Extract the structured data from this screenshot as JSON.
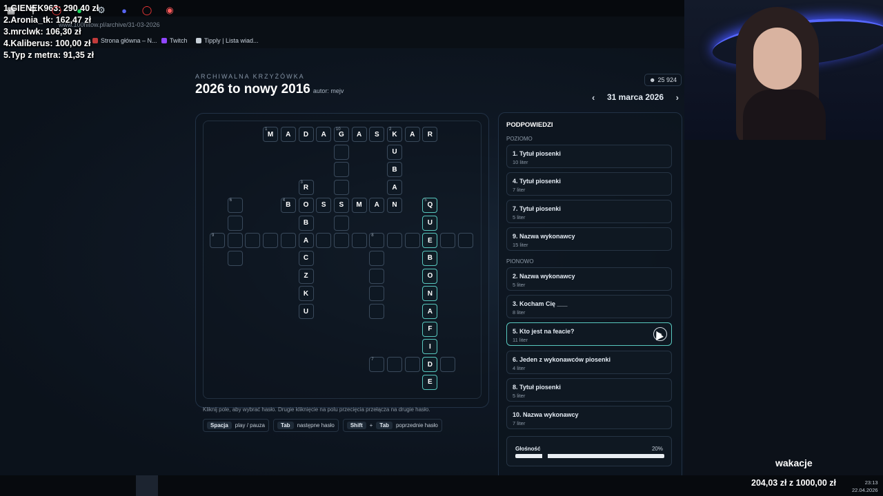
{
  "browser": {
    "url": "www.100hitow.pl/archive/31-03-2026",
    "bookmarks": [
      "Strona główna – N...",
      "Twitch",
      "Tipply | Lista wiad..."
    ]
  },
  "donors": [
    "1.GIENEK963: 290,40 zł",
    "2.Aronia_tk: 162,47 zł",
    "3.mrclwk: 106,30 zł",
    "4.Kaliberus: 100,00 zł",
    "5.Typ z metra: 91,35 zł"
  ],
  "header": {
    "subtitle": "ARCHIWALNA KRZYŻÓWKA",
    "title": "2026 to nowy 2016",
    "author": "autor: mejv",
    "count": "25 924",
    "date": "31 marca 2026"
  },
  "grid": {
    "cells": [
      {
        "r": 0,
        "c": 3,
        "n": "1",
        "ch": "M"
      },
      {
        "r": 0,
        "c": 4,
        "ch": "A"
      },
      {
        "r": 0,
        "c": 5,
        "ch": "D"
      },
      {
        "r": 0,
        "c": 6,
        "ch": "A"
      },
      {
        "r": 0,
        "c": 7,
        "n": "10",
        "ch": "G"
      },
      {
        "r": 0,
        "c": 8,
        "ch": "A"
      },
      {
        "r": 0,
        "c": 9,
        "ch": "S"
      },
      {
        "r": 0,
        "c": 10,
        "n": "2",
        "ch": "K"
      },
      {
        "r": 0,
        "c": 11,
        "ch": "A"
      },
      {
        "r": 0,
        "c": 12,
        "ch": "R"
      },
      {
        "r": 1,
        "c": 7,
        "ch": ""
      },
      {
        "r": 1,
        "c": 10,
        "ch": "U"
      },
      {
        "r": 2,
        "c": 7,
        "ch": ""
      },
      {
        "r": 2,
        "c": 10,
        "ch": "B"
      },
      {
        "r": 3,
        "c": 5,
        "n": "3",
        "ch": "R"
      },
      {
        "r": 3,
        "c": 7,
        "ch": ""
      },
      {
        "r": 3,
        "c": 10,
        "ch": "A"
      },
      {
        "r": 4,
        "c": 1,
        "n": "6",
        "ch": ""
      },
      {
        "r": 4,
        "c": 4,
        "n": "4",
        "ch": "B"
      },
      {
        "r": 4,
        "c": 5,
        "ch": "O"
      },
      {
        "r": 4,
        "c": 6,
        "ch": "S"
      },
      {
        "r": 4,
        "c": 7,
        "ch": "S"
      },
      {
        "r": 4,
        "c": 8,
        "ch": "M"
      },
      {
        "r": 4,
        "c": 9,
        "ch": "A"
      },
      {
        "r": 4,
        "c": 10,
        "ch": "N"
      },
      {
        "r": 4,
        "c": 12,
        "n": "5",
        "ch": "Q",
        "hl": true
      },
      {
        "r": 5,
        "c": 1,
        "ch": ""
      },
      {
        "r": 5,
        "c": 5,
        "ch": "B"
      },
      {
        "r": 5,
        "c": 7,
        "ch": ""
      },
      {
        "r": 5,
        "c": 12,
        "ch": "U",
        "hl": true
      },
      {
        "r": 6,
        "c": 0,
        "n": "9",
        "ch": ""
      },
      {
        "r": 6,
        "c": 1,
        "ch": ""
      },
      {
        "r": 6,
        "c": 2,
        "ch": ""
      },
      {
        "r": 6,
        "c": 3,
        "ch": ""
      },
      {
        "r": 6,
        "c": 4,
        "ch": ""
      },
      {
        "r": 6,
        "c": 5,
        "ch": "A"
      },
      {
        "r": 6,
        "c": 6,
        "ch": ""
      },
      {
        "r": 6,
        "c": 7,
        "ch": ""
      },
      {
        "r": 6,
        "c": 8,
        "ch": ""
      },
      {
        "r": 6,
        "c": 9,
        "n": "8",
        "ch": ""
      },
      {
        "r": 6,
        "c": 10,
        "ch": ""
      },
      {
        "r": 6,
        "c": 11,
        "ch": ""
      },
      {
        "r": 6,
        "c": 12,
        "ch": "E",
        "hl": true
      },
      {
        "r": 6,
        "c": 13,
        "ch": ""
      },
      {
        "r": 6,
        "c": 14,
        "ch": ""
      },
      {
        "r": 7,
        "c": 1,
        "ch": ""
      },
      {
        "r": 7,
        "c": 5,
        "ch": "C"
      },
      {
        "r": 7,
        "c": 9,
        "ch": ""
      },
      {
        "r": 7,
        "c": 12,
        "ch": "B",
        "hl": true
      },
      {
        "r": 8,
        "c": 5,
        "ch": "Z"
      },
      {
        "r": 8,
        "c": 9,
        "ch": ""
      },
      {
        "r": 8,
        "c": 12,
        "ch": "O",
        "hl": true
      },
      {
        "r": 9,
        "c": 5,
        "ch": "K"
      },
      {
        "r": 9,
        "c": 9,
        "ch": ""
      },
      {
        "r": 9,
        "c": 12,
        "ch": "N",
        "hl": true
      },
      {
        "r": 10,
        "c": 5,
        "ch": "U"
      },
      {
        "r": 10,
        "c": 9,
        "ch": ""
      },
      {
        "r": 10,
        "c": 12,
        "ch": "A",
        "hl": true
      },
      {
        "r": 11,
        "c": 12,
        "ch": "F",
        "hl": true
      },
      {
        "r": 12,
        "c": 12,
        "ch": "I",
        "hl": true
      },
      {
        "r": 13,
        "c": 9,
        "n": "7",
        "ch": ""
      },
      {
        "r": 13,
        "c": 10,
        "ch": ""
      },
      {
        "r": 13,
        "c": 11,
        "ch": ""
      },
      {
        "r": 13,
        "c": 12,
        "ch": "D",
        "hl": true
      },
      {
        "r": 13,
        "c": 13,
        "ch": ""
      },
      {
        "r": 14,
        "c": 12,
        "ch": "E",
        "hl": true
      }
    ]
  },
  "instructions": {
    "hint": "Kliknij pole, aby wybrać hasło. Drugie kliknięcie na polu przecięcia przełącza na drugie hasło.",
    "space_key": "Spacja",
    "space_desc": "play / pauza",
    "tab_key": "Tab",
    "tab_desc": "następne hasło",
    "shift_key": "Shift",
    "plus": "+",
    "tab2_key": "Tab",
    "prev_desc": "poprzednie hasło"
  },
  "panel": {
    "title": "PODPOWIEDZI",
    "across_label": "POZIOMO",
    "down_label": "PIONOWO",
    "across": [
      {
        "t": "1. Tytuł piosenki",
        "l": "10 liter"
      },
      {
        "t": "4. Tytuł piosenki",
        "l": "7 liter"
      },
      {
        "t": "7. Tytuł piosenki",
        "l": "5 liter"
      },
      {
        "t": "9. Nazwa wykonawcy",
        "l": "15 liter"
      }
    ],
    "down": [
      {
        "t": "2. Nazwa wykonawcy",
        "l": "5 liter"
      },
      {
        "t": "3. Kocham Cię ___",
        "l": "8 liter"
      },
      {
        "t": "5. Kto jest na feacie?",
        "l": "11 liter"
      },
      {
        "t": "6. Jeden z wykonawców piosenki",
        "l": "4 liter"
      },
      {
        "t": "8. Tytuł piosenki",
        "l": "5 liter"
      },
      {
        "t": "10. Nazwa wykonawcy",
        "l": "7 liter"
      }
    ],
    "volume_label": "Głośność",
    "volume_value": "20%",
    "volume_level": 0.2
  },
  "stream": {
    "overlay_text": "wakacje",
    "goal": "204,03 zł z 1000,00 zł",
    "time": "23:13",
    "date": "22.04.2026"
  }
}
